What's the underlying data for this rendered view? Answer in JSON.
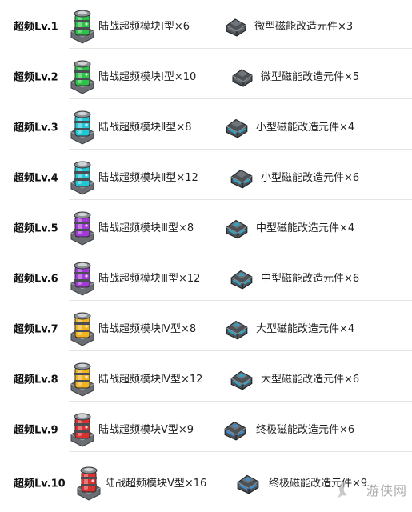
{
  "rows": [
    {
      "level": "超频Lv.1",
      "module": "陆战超频模块Ⅰ型×6",
      "module_color": "#2ec24a",
      "part": "微型磁能改造元件×3",
      "part_size": "micro"
    },
    {
      "level": "超频Lv.2",
      "module": "陆战超频模块Ⅰ型×10",
      "module_color": "#2ec24a",
      "part": "微型磁能改造元件×5",
      "part_size": "micro"
    },
    {
      "level": "超频Lv.3",
      "module": "陆战超频模块Ⅱ型×8",
      "module_color": "#22c6d4",
      "part": "小型磁能改造元件×4",
      "part_size": "small"
    },
    {
      "level": "超频Lv.4",
      "module": "陆战超频模块Ⅱ型×12",
      "module_color": "#22c6d4",
      "part": "小型磁能改造元件×6",
      "part_size": "small"
    },
    {
      "level": "超频Lv.5",
      "module": "陆战超频模块Ⅲ型×8",
      "module_color": "#a23ad8",
      "part": "中型磁能改造元件×4",
      "part_size": "medium"
    },
    {
      "level": "超频Lv.6",
      "module": "陆战超频模块Ⅲ型×12",
      "module_color": "#a23ad8",
      "part": "中型磁能改造元件×6",
      "part_size": "medium"
    },
    {
      "level": "超频Lv.7",
      "module": "陆战超频模块Ⅳ型×8",
      "module_color": "#f0b321",
      "part": "大型磁能改造元件×4",
      "part_size": "large"
    },
    {
      "level": "超频Lv.8",
      "module": "陆战超频模块Ⅳ型×12",
      "module_color": "#f0b321",
      "part": "大型磁能改造元件×6",
      "part_size": "large"
    },
    {
      "level": "超频Lv.9",
      "module": "陆战超频模块Ⅴ型×9",
      "module_color": "#d93030",
      "part": "终极磁能改造元件×6",
      "part_size": "ultimate"
    },
    {
      "level": "超频Lv.10",
      "module": "陆战超频模块Ⅴ型×16",
      "module_color": "#d93030",
      "part": "终极磁能改造元件×9",
      "part_size": "ultimate"
    }
  ],
  "watermark": "游侠网"
}
